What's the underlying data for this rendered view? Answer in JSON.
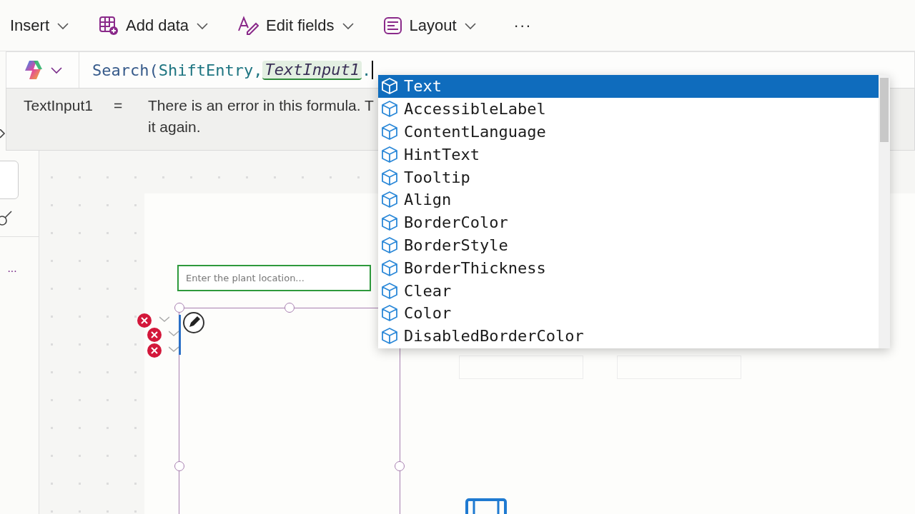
{
  "toolbar": {
    "items": [
      {
        "label": "Insert",
        "kind": "plain"
      },
      {
        "label": "Add data",
        "kind": "table"
      },
      {
        "label": "Edit fields",
        "kind": "pen"
      },
      {
        "label": "Layout",
        "kind": "layout"
      }
    ],
    "more": "···"
  },
  "formula_bar": {
    "formula": [
      {
        "text": "Search(",
        "kind": "function"
      },
      {
        "text": "ShiftEntry",
        "kind": "name"
      },
      {
        "text": ",",
        "kind": "plain"
      },
      {
        "text": "TextInput1",
        "kind": "control"
      },
      {
        "text": ".",
        "kind": "plain"
      }
    ]
  },
  "error_tip": {
    "name": "TextInput1",
    "equals": "=",
    "lines": [
      "There is an error in this formula. T",
      "it again."
    ]
  },
  "suggestions": [
    {
      "label": "Text",
      "selected": true
    },
    {
      "label": "AccessibleLabel",
      "selected": false
    },
    {
      "label": "ContentLanguage",
      "selected": false
    },
    {
      "label": "HintText",
      "selected": false
    },
    {
      "label": "Tooltip",
      "selected": false
    },
    {
      "label": "Align",
      "selected": false
    },
    {
      "label": "BorderColor",
      "selected": false
    },
    {
      "label": "BorderStyle",
      "selected": false
    },
    {
      "label": "BorderThickness",
      "selected": false
    },
    {
      "label": "Clear",
      "selected": false
    },
    {
      "label": "Color",
      "selected": false
    },
    {
      "label": "DisabledBorderColor",
      "selected": false
    }
  ],
  "canvas": {
    "sidebar_more": "···",
    "text_input": {
      "placeholder": "Enter the plant location..."
    }
  }
}
